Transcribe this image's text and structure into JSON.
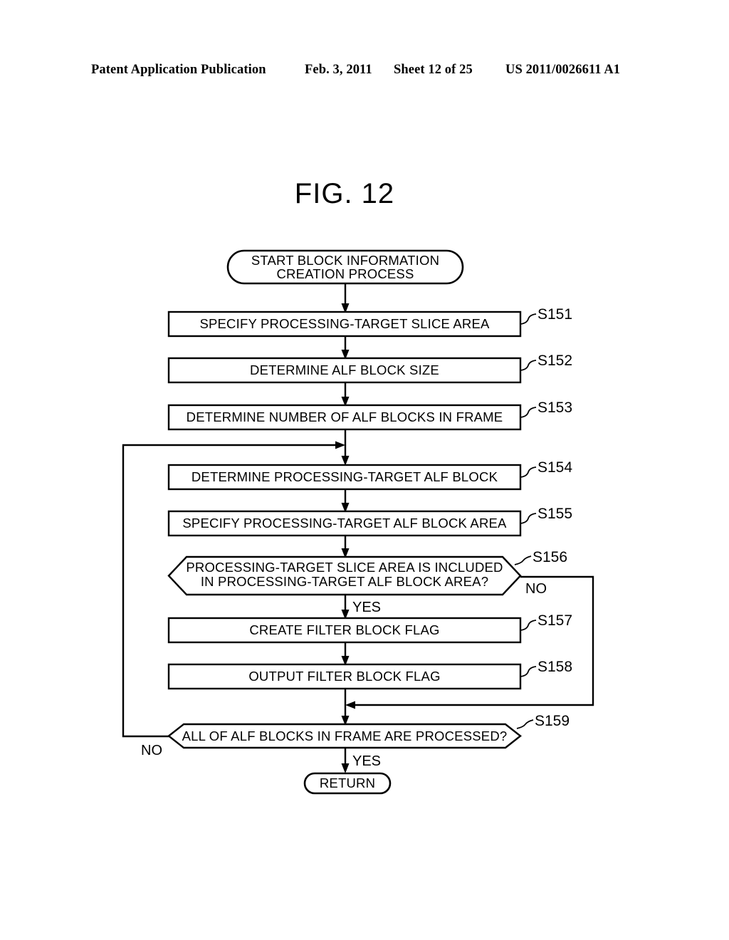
{
  "header": {
    "publication": "Patent Application Publication",
    "date": "Feb. 3, 2011",
    "sheet": "Sheet 12 of 25",
    "number": "US 2011/0026611 A1"
  },
  "figure": {
    "title": "FIG. 12",
    "start": {
      "label_line1": "START BLOCK INFORMATION",
      "label_line2": "CREATION PROCESS"
    },
    "steps": [
      {
        "id": "S151",
        "label": "SPECIFY PROCESSING-TARGET SLICE AREA"
      },
      {
        "id": "S152",
        "label": "DETERMINE ALF BLOCK SIZE"
      },
      {
        "id": "S153",
        "label": "DETERMINE NUMBER OF ALF BLOCKS IN FRAME"
      },
      {
        "id": "S154",
        "label": "DETERMINE PROCESSING-TARGET ALF BLOCK"
      },
      {
        "id": "S155",
        "label": "SPECIFY PROCESSING-TARGET ALF BLOCK AREA"
      },
      {
        "id": "S157",
        "label": "CREATE FILTER BLOCK FLAG"
      },
      {
        "id": "S158",
        "label": "OUTPUT FILTER BLOCK FLAG"
      }
    ],
    "decisions": [
      {
        "id": "S156",
        "label_line1": "PROCESSING-TARGET SLICE AREA IS INCLUDED",
        "label_line2": "IN PROCESSING-TARGET ALF BLOCK AREA?",
        "yes_label": "YES",
        "no_label": "NO"
      },
      {
        "id": "S159",
        "label_line1": "ALL OF ALF BLOCKS IN FRAME ARE PROCESSED?",
        "label_line2": "",
        "yes_label": "YES",
        "no_label": "NO"
      }
    ],
    "end": {
      "label": "RETURN"
    },
    "colors": {
      "ink": "#000000",
      "paper": "#ffffff"
    }
  }
}
